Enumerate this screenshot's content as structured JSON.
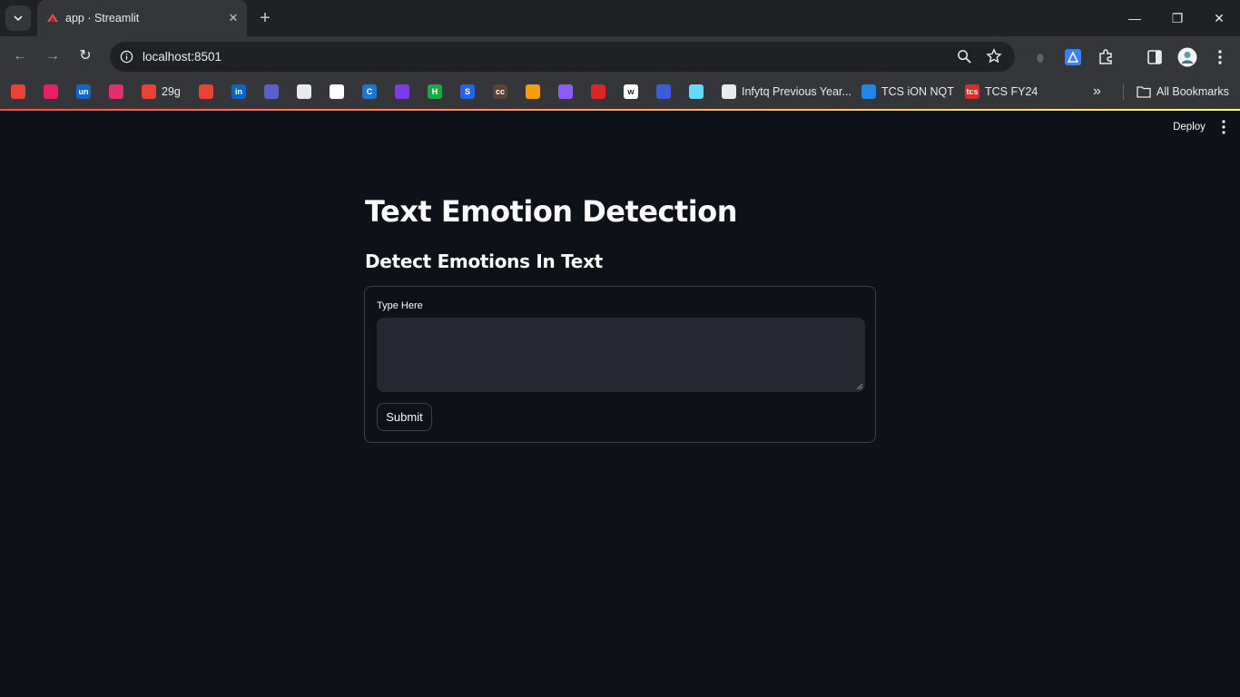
{
  "browser": {
    "tab_title": "app · Streamlit",
    "close_glyph": "✕",
    "new_tab_glyph": "+",
    "url": "localhost:8501",
    "nav": {
      "back": "←",
      "forward": "→",
      "reload": "↻"
    },
    "window_controls": {
      "minimize": "—",
      "restore": "❐",
      "close": "✕"
    },
    "bookmarks": [
      {
        "icon": "gmail-icon",
        "label": "",
        "color": "#ea4335"
      },
      {
        "icon": "hexagon-icon",
        "label": "",
        "color": "#e91e63"
      },
      {
        "icon": "unstop-icon",
        "label": "",
        "color": "#1565c0",
        "glyph": "un"
      },
      {
        "icon": "instagram-icon",
        "label": "",
        "color": "#e1306c"
      },
      {
        "icon": "gmail-icon",
        "label": "29g",
        "color": "#ea4335"
      },
      {
        "icon": "gmail-icon",
        "label": "",
        "color": "#ea4335"
      },
      {
        "icon": "linkedin-icon",
        "label": "",
        "color": "#0a66c2",
        "glyph": "in"
      },
      {
        "icon": "teams-icon",
        "label": "",
        "color": "#5b5fc7"
      },
      {
        "icon": "github-icon",
        "label": "",
        "color": "#e8eaed"
      },
      {
        "icon": "app-icon",
        "label": "",
        "color": "#ffffff"
      },
      {
        "icon": "c-icon",
        "label": "",
        "color": "#1976d2",
        "glyph": "C"
      },
      {
        "icon": "shield-icon",
        "label": "",
        "color": "#7c3aed"
      },
      {
        "icon": "hackerrank-icon",
        "label": "",
        "color": "#1ba94c",
        "glyph": "H"
      },
      {
        "icon": "s-icon",
        "label": "",
        "color": "#2563eb",
        "glyph": "S"
      },
      {
        "icon": "cc-icon",
        "label": "",
        "color": "#5d4037",
        "glyph": "cc"
      },
      {
        "icon": "leetcode-icon",
        "label": "",
        "color": "#f59e0b"
      },
      {
        "icon": "spiral-icon",
        "label": "",
        "color": "#8b5cf6"
      },
      {
        "icon": "inbox-icon",
        "label": "",
        "color": "#dc2626"
      },
      {
        "icon": "w-icon",
        "label": "",
        "color": "#ffffff",
        "glyph": "w"
      },
      {
        "icon": "wave-icon",
        "label": "",
        "color": "#3b5bdb"
      },
      {
        "icon": "react-icon",
        "label": "",
        "color": "#61dafb"
      },
      {
        "icon": "doc-icon",
        "label": "Infytq Previous Year...",
        "color": "#e8eaed"
      },
      {
        "icon": "power-icon",
        "label": "TCS iON NQT",
        "color": "#1e88e5"
      },
      {
        "icon": "tcs-icon",
        "label": "TCS FY24",
        "color": "#d32f2f",
        "glyph": "tcs"
      }
    ],
    "overflow_glyph": "»",
    "all_bookmarks": "All Bookmarks"
  },
  "app": {
    "deploy_label": "Deploy",
    "title": "Text Emotion Detection",
    "subtitle": "Detect Emotions In Text",
    "form": {
      "field_label": "Type Here",
      "field_value": "",
      "submit_label": "Submit"
    },
    "colors": {
      "background": "#0e1117",
      "input_bg": "#262730",
      "text": "#fafafa",
      "accent_start": "#ff4b4b",
      "accent_end": "#fffd80"
    }
  }
}
